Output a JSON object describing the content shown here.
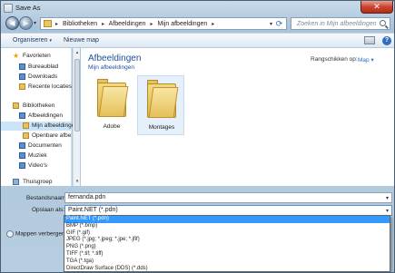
{
  "window": {
    "title": "Save As",
    "close_glyph": "✕"
  },
  "nav": {
    "back_glyph": "◀",
    "forward_glyph": "▶",
    "dropdown_glyph": "▾"
  },
  "address": {
    "crumbs": [
      "Bibliotheken",
      "Afbeeldingen",
      "Mijn afbeeldingen"
    ],
    "separator": "▸",
    "refresh_glyph": "⟳"
  },
  "search": {
    "placeholder": "Zoeken in Mijn afbeeldingen"
  },
  "toolbar": {
    "organize": "Organiseren",
    "new_folder": "Nieuwe map",
    "caret": "▾",
    "help": "?"
  },
  "sidebar": {
    "items": [
      {
        "label": "Favorieten",
        "icon": "star-icon"
      },
      {
        "label": "Bureaublad",
        "icon": "desktop-icon"
      },
      {
        "label": "Downloads",
        "icon": "downloads-icon"
      },
      {
        "label": "Recente locaties",
        "icon": "recent-icon"
      },
      {
        "label": "Bibliotheken",
        "icon": "library-icon"
      },
      {
        "label": "Afbeeldingen",
        "icon": "pictures-icon"
      },
      {
        "label": "Mijn afbeeldingen",
        "icon": "folder-icon"
      },
      {
        "label": "Openbare afbe",
        "icon": "folder-icon"
      },
      {
        "label": "Documenten",
        "icon": "documents-icon"
      },
      {
        "label": "Muziek",
        "icon": "music-icon"
      },
      {
        "label": "Video's",
        "icon": "videos-icon"
      },
      {
        "label": "Thuisgroep",
        "icon": "homegroup-icon"
      }
    ],
    "star_glyph": "★",
    "scroll_up": "▴",
    "scroll_down": "▾"
  },
  "main": {
    "title": "Afbeeldingen",
    "subtitle": "Mijn afbeeldingen",
    "arrange_label": "Rangschikken op:",
    "arrange_value": "Map",
    "arrange_caret": "▾",
    "folders": [
      {
        "name": "Adobe"
      },
      {
        "name": "Montages"
      }
    ]
  },
  "bottom": {
    "filename_label": "Bestandsnaam:",
    "filename_value": "fernanda.pdn",
    "filetype_label": "Opslaan als:",
    "filetype_value": "Paint.NET (*.pdn)",
    "caret": "▾",
    "hide_folders": "Mappen verbergen"
  },
  "filetype_options": [
    "Paint.NET (*.pdn)",
    "BMP (*.bmp)",
    "GIF (*.gif)",
    "JPEG (*.jpg; *.jpeg; *.jpe; *.jfif)",
    "PNG (*.png)",
    "TIFF (*.tif; *.tiff)",
    "TGA (*.tga)",
    "DirectDraw Surface (DDS) (*.dds)"
  ],
  "colors": {
    "accent": "#1e4f9a",
    "highlight": "#3399ff",
    "close": "#c9452f"
  }
}
